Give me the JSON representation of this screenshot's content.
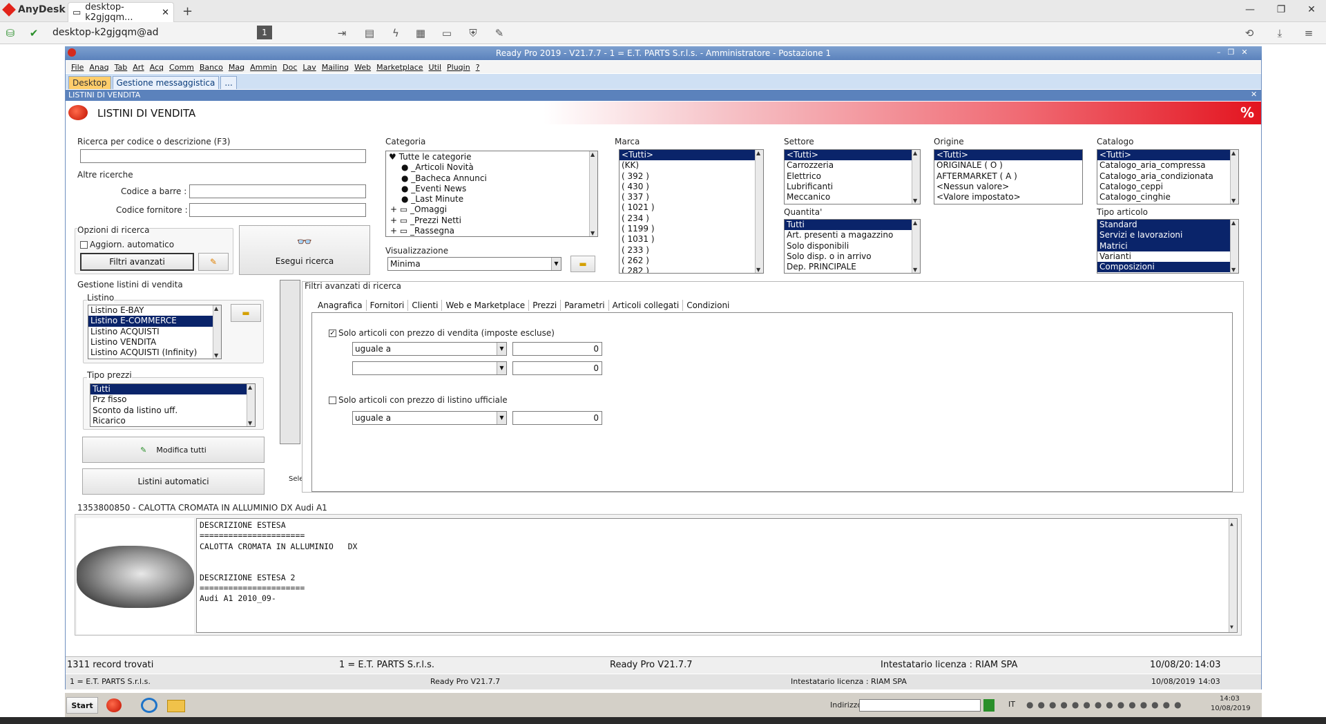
{
  "anydesk": {
    "brand": "AnyDesk",
    "tab_label": "desktop-k2gjgqm...",
    "address": "desktop-k2gjgqm@ad",
    "session_number": "1"
  },
  "app": {
    "title": "Ready Pro 2019 - V21.7.7 - 1 = E.T. PARTS S.r.l.s. - Amministratore - Postazione 1",
    "menu": [
      "File",
      "Anag",
      "Tab",
      "Art",
      "Acq",
      "Comm",
      "Banco",
      "Mag",
      "Ammin",
      "Doc",
      "Lav",
      "Mailing",
      "Web",
      "Marketplace",
      "Util",
      "Plugin",
      "?"
    ],
    "tabs": [
      "Desktop",
      "Gestione messaggistica",
      "..."
    ],
    "section_title": "LISTINI DI VENDITA",
    "banner_title": "LISTINI DI VENDITA",
    "banner_icon": "%"
  },
  "search": {
    "code_label": "Ricerca per codice o descrizione (F3)",
    "code_value": "",
    "other_label": "Altre ricerche",
    "barcode_label": "Codice a barre :",
    "supplier_label": "Codice fornitore :",
    "options_label": "Opzioni di ricerca",
    "auto_update_label": "Aggiorn. automatico",
    "advanced_filters_button": "Filtri avanzati",
    "run_search_button": "Esegui ricerca"
  },
  "categoria": {
    "label": "Categoria",
    "items": [
      "Tutte le categorie",
      "_Articoli Novità",
      "_Bacheca Annunci",
      "_Eventi News",
      "_Last Minute",
      "_Omaggi",
      "_Prezzi Netti",
      "_Rassegna"
    ]
  },
  "marca": {
    "label": "Marca",
    "items": [
      "<Tutti>",
      "(KK)",
      "( 392 )",
      "( 430 )",
      "( 337 )",
      "( 1021 )",
      "( 234 )",
      "( 1199 )",
      "( 1031 )",
      "( 233 )",
      "( 262 )",
      "( 282 )"
    ]
  },
  "settore": {
    "label": "Settore",
    "items": [
      "<Tutti>",
      "Carrozzeria",
      "Elettrico",
      "Lubrificanti",
      "Meccanico"
    ]
  },
  "origine": {
    "label": "Origine",
    "items": [
      "<Tutti>",
      "ORIGINALE ( O )",
      "AFTERMARKET ( A )",
      "<Nessun valore>",
      "<Valore impostato>"
    ]
  },
  "catalogo": {
    "label": "Catalogo",
    "items": [
      "<Tutti>",
      "Catalogo_aria_compressa",
      "Catalogo_aria_condizionata",
      "Catalogo_ceppi",
      "Catalogo_cinghie"
    ]
  },
  "quantita": {
    "label": "Quantita'",
    "items": [
      "Tutti",
      "Art. presenti a magazzino",
      "Solo disponibili",
      "Solo disp. o in arrivo",
      "Dep. PRINCIPALE"
    ]
  },
  "tipo_articolo": {
    "label": "Tipo articolo",
    "items": [
      "Standard",
      "Servizi e lavorazioni",
      "Matrici",
      "Varianti",
      "Composizioni"
    ]
  },
  "visualizzazione": {
    "label": "Visualizzazione",
    "value": "Minima"
  },
  "gestione": {
    "label": "Gestione listini di vendita",
    "listino_label": "Listino",
    "listino_items": [
      "Listino E-BAY",
      "Listino E-COMMERCE",
      "Listino ACQUISTI",
      "Listino VENDITA",
      "Listino ACQUISTI (Infinity)"
    ],
    "tipo_prezzi_label": "Tipo prezzi",
    "tipo_prezzi_items": [
      "Tutti",
      "Prz fisso",
      "Sconto da listino uff.",
      "Ricarico"
    ],
    "modifica_tutti": "Modifica tutti",
    "listini_automatici": "Listini automatici",
    "sele": "Sele"
  },
  "filtri": {
    "title": "Filtri avanzati di ricerca",
    "tabs": [
      "Anagrafica",
      "Fornitori",
      "Clienti",
      "Web e Marketplace",
      "Prezzi",
      "Parametri",
      "Articoli collegati",
      "Condizioni"
    ],
    "check1_label": "Solo articoli con prezzo di vendita (imposte escluse)",
    "combo1": "uguale a",
    "num1": "0",
    "combo2": "",
    "num2": "0",
    "check2_label": "Solo articoli con prezzo di listino ufficiale",
    "combo3": "uguale a",
    "num3": "0"
  },
  "detail": {
    "header": "1353800850 - CALOTTA CROMATA IN ALLUMINIO DX Audi A1",
    "lines": [
      "DESCRIZIONE ESTESA",
      "======================",
      "CALOTTA CROMATA IN ALLUMINIO   DX",
      "",
      "DESCRIZIONE ESTESA 2",
      "======================",
      "Audi A1 2010_09-"
    ]
  },
  "status": {
    "records": "1311 record trovati",
    "company": "1 = E.T. PARTS S.r.l.s.",
    "version": "Ready Pro V21.7.7",
    "license": "Intestatario licenza : RIAM SPA",
    "date": "10/08/20:",
    "time": "14:03"
  },
  "status2": {
    "company": "1 = E.T. PARTS S.r.l.s.",
    "version": "Ready Pro V21.7.7",
    "license": "Intestatario licenza : RIAM SPA",
    "date": "10/08/2019",
    "time": "14:03"
  },
  "taskbar": {
    "start": "Start",
    "indirizzo": "Indirizzo",
    "lang": "IT",
    "clock_time": "14:03",
    "clock_date": "10/08/2019"
  }
}
